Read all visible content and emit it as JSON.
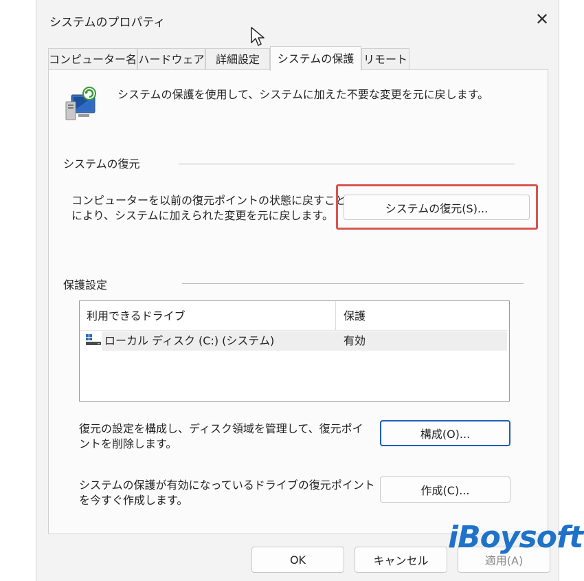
{
  "window": {
    "title": "システムのプロパティ"
  },
  "tabs": [
    {
      "label": "コンピューター名",
      "active": false
    },
    {
      "label": "ハードウェア",
      "active": false
    },
    {
      "label": "詳細設定",
      "active": false
    },
    {
      "label": "システムの保護",
      "active": true
    },
    {
      "label": "リモート",
      "active": false
    }
  ],
  "intro": {
    "text": "システムの保護を使用して、システムに加えた不要な変更を元に戻します。",
    "icon": "system-protection-icon"
  },
  "restore": {
    "heading": "システムの復元",
    "desc_line1": "コンピューターを以前の復元ポイントの状態に戻すこと",
    "desc_line2": "により、システムに加えられた変更を元に戻します。",
    "button_label": "システムの復元(S)..."
  },
  "protection": {
    "heading": "保護設定",
    "columns": {
      "drive": "利用できるドライブ",
      "protection": "保護"
    },
    "rows": [
      {
        "drive": "ローカル ディスク (C:) (システム)",
        "protection": "有効"
      }
    ]
  },
  "configure": {
    "desc_line1": "復元の設定を構成し、ディスク領域を管理して、復元ポイ",
    "desc_line2": "ントを削除します。",
    "button_label": "構成(O)..."
  },
  "create": {
    "desc_line1": "システムの保護が有効になっているドライブの復元ポイント",
    "desc_line2": "を今すぐ作成します。",
    "button_label": "作成(C)..."
  },
  "footer": {
    "ok_label": "OK",
    "cancel_label": "キャンセル",
    "apply_label": "適用(A)"
  },
  "watermark": {
    "text": "iBoysoft"
  },
  "colors": {
    "highlight": "#d9534f",
    "focus": "#1a5fb4",
    "logo": "#1f72c9"
  }
}
